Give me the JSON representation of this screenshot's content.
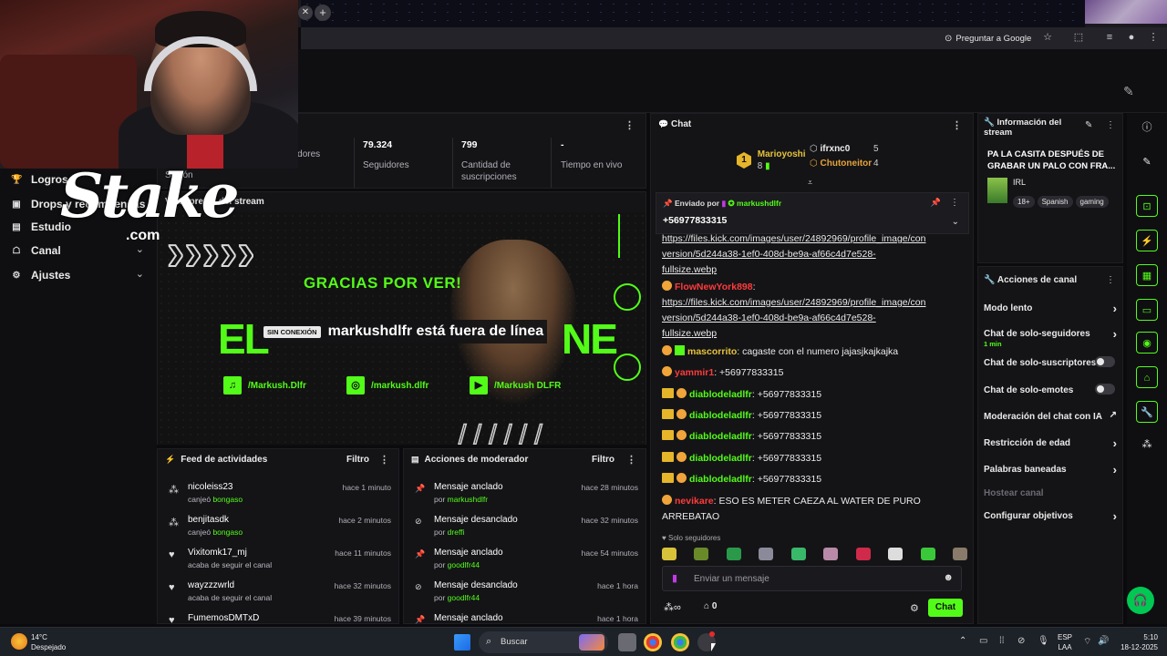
{
  "browser": {
    "ask_google": "Preguntar a Google"
  },
  "sidebar": {
    "items": [
      {
        "label": "Logros"
      },
      {
        "label": "Drops y recompensas"
      },
      {
        "label": "Estudio"
      },
      {
        "label": "Canal"
      },
      {
        "label": "Ajustes"
      }
    ]
  },
  "overlay": {
    "brand": "Stake",
    "brand_domain": ".com"
  },
  "stats": {
    "session_label": "Sesión",
    "items": [
      {
        "value": "",
        "label": "Espectadores"
      },
      {
        "value": "79.324",
        "label": "Seguidores"
      },
      {
        "value": "799",
        "label": "Cantidad de suscripciones"
      },
      {
        "value": "-",
        "label": "Tiempo en vivo"
      }
    ]
  },
  "preview": {
    "title": "Vista previa del stream",
    "offline_chip": "SIN CONEXIÓN",
    "offline_message": "markushdlfr está fuera de línea",
    "art_thanks": "GRACIAS POR VER!",
    "art_left": "EL",
    "art_right": "NE",
    "socials": [
      {
        "handle": "/Markush.Dlfr",
        "icon": "spotify-icon"
      },
      {
        "handle": "/markush.dlfr",
        "icon": "instagram-icon"
      },
      {
        "handle": "/Markush DLFR",
        "icon": "youtube-icon"
      }
    ]
  },
  "feed": {
    "title": "Feed de actividades",
    "filter": "Filtro",
    "rows": [
      {
        "name": "nicoleiss23",
        "action": "canjeó",
        "highlight": "bongaso",
        "time": "hace 1 minuto",
        "icon": "redeem-icon"
      },
      {
        "name": "benjitasdk",
        "action": "canjeó",
        "highlight": "bongaso",
        "time": "hace 2 minutos",
        "icon": "redeem-icon"
      },
      {
        "name": "Vixitomk17_mj",
        "action": "acaba de seguir el canal",
        "highlight": "",
        "time": "hace 11 minutos",
        "icon": "heart-icon"
      },
      {
        "name": "wayzzzwrld",
        "action": "acaba de seguir el canal",
        "highlight": "",
        "time": "hace 32 minutos",
        "icon": "heart-icon"
      },
      {
        "name": "FumemosDMTxD",
        "action": "",
        "highlight": "",
        "time": "hace 39 minutos",
        "icon": "heart-icon"
      }
    ]
  },
  "mod": {
    "title": "Acciones de moderador",
    "filter": "Filtro",
    "rows": [
      {
        "name": "Mensaje anclado",
        "by": "por",
        "user": "markushdlfr",
        "time": "hace 28 minutos",
        "icon": "pin-icon"
      },
      {
        "name": "Mensaje desanclado",
        "by": "por",
        "user": "dreffi",
        "time": "hace 32 minutos",
        "icon": "unpin-icon"
      },
      {
        "name": "Mensaje anclado",
        "by": "por",
        "user": "goodlfr44",
        "time": "hace 54 minutos",
        "icon": "pin-icon"
      },
      {
        "name": "Mensaje desanclado",
        "by": "por",
        "user": "goodlfr44",
        "time": "hace 1 hora",
        "icon": "unpin-icon"
      },
      {
        "name": "Mensaje anclado",
        "by": "",
        "user": "",
        "time": "hace 1 hora",
        "icon": "pin-icon"
      }
    ]
  },
  "chat": {
    "title": "Chat",
    "gifters": [
      {
        "rank": "1",
        "name": "Marioyoshi",
        "count": "8"
      },
      {
        "rank": "",
        "name": "ifrxnc0",
        "count": "5"
      },
      {
        "rank": "",
        "name": "Chutoneitor",
        "count": "4"
      }
    ],
    "pinned_by_label": "Enviado por",
    "pinned_user": "markushdlfr",
    "pinned_text": "+56977833315",
    "link_part1": "https://files.kick.com/images/user/24892969/profile_image/con",
    "link_part2": "version/5d244a38-1ef0-408d-be9a-af66c4d7e528-",
    "link_part3": "fullsize.webp",
    "flow_user": "FlowNewYork898",
    "flow_link1": "https://files.kick.com/images/user/24892969/profile_image/con",
    "flow_link2": "version/5d244a38-1ef0-408d-be9a-af66c4d7e528-",
    "flow_link3": "fullsize.webp",
    "messages": [
      {
        "user": "mascorrito",
        "text": "cagaste con el numero jajasjkajkajka"
      },
      {
        "user": "yammir1",
        "text": "+56977833315"
      },
      {
        "user": "diablodeladlfr",
        "text": "+56977833315"
      },
      {
        "user": "diablodeladlfr",
        "text": "+56977833315"
      },
      {
        "user": "diablodeladlfr",
        "text": "+56977833315"
      },
      {
        "user": "diablodeladlfr",
        "text": "+56977833315"
      },
      {
        "user": "diablodeladlfr",
        "text": "+56977833315"
      }
    ],
    "last_user": "nevikare",
    "last_text": "ESO ES METER CAEZA AL WATER DE PURO ARREBATAO",
    "followers_only": "Solo seguidores",
    "input_placeholder": "Enviar un mensaje",
    "points": "0",
    "send": "Chat"
  },
  "stream_info": {
    "title": "Información del stream",
    "stream_title": "PA LA CASITA DESPUÉS DE GRABAR UN PALO CON FRA...",
    "category": "IRL",
    "tags": [
      "18+",
      "Spanish",
      "gaming"
    ]
  },
  "channel_actions": {
    "title": "Acciones de canal",
    "items": [
      {
        "label": "Modo lento",
        "kind": "arrow",
        "sub": ""
      },
      {
        "label": "Chat de solo-seguidores",
        "kind": "arrow",
        "sub": "1 min"
      },
      {
        "label": "Chat de solo-suscriptores",
        "kind": "toggle",
        "sub": ""
      },
      {
        "label": "Chat de solo-emotes",
        "kind": "toggle",
        "sub": ""
      },
      {
        "label": "Moderación del chat con IA",
        "kind": "external",
        "sub": ""
      },
      {
        "label": "Restricción de edad",
        "kind": "arrow",
        "sub": ""
      },
      {
        "label": "Palabras baneadas",
        "kind": "arrow",
        "sub": ""
      },
      {
        "label": "Hostear canal",
        "kind": "disabled",
        "sub": ""
      },
      {
        "label": "Configurar objetivos",
        "kind": "arrow",
        "sub": ""
      }
    ]
  },
  "taskbar": {
    "weather_temp": "14°C",
    "weather_desc": "Despejado",
    "search": "Buscar",
    "lang1": "ESP",
    "lang2": "LAA",
    "time": "5:10",
    "date": "18-12-2025"
  },
  "colors": {
    "accent": "#53fc18",
    "panel": "#141417",
    "danger": "#ff3b3b"
  }
}
